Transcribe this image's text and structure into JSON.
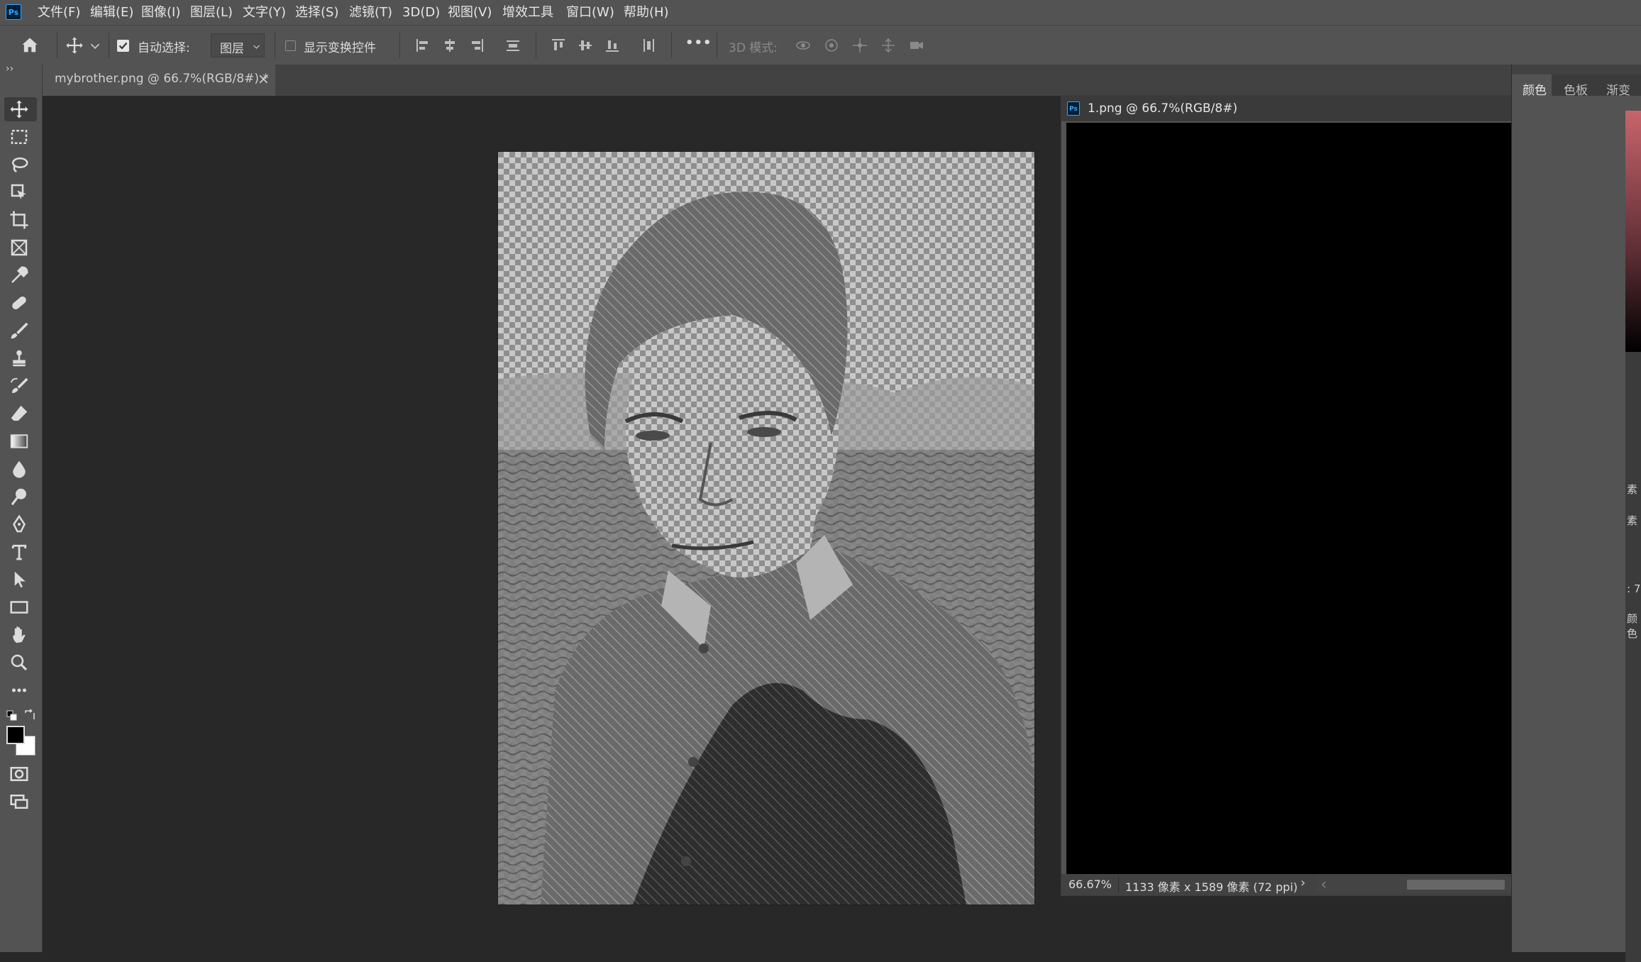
{
  "menubar": {
    "app_logo": "Ps",
    "items": [
      "文件(F)",
      "编辑(E)",
      "图像(I)",
      "图层(L)",
      "文字(Y)",
      "选择(S)",
      "滤镜(T)",
      "3D(D)",
      "视图(V)",
      "增效工具",
      "窗口(W)",
      "帮助(H)"
    ]
  },
  "options": {
    "auto_select_label": "自动选择:",
    "auto_select_checked": true,
    "auto_select_target": "图层",
    "show_transform_label": "显示变换控件",
    "show_transform_checked": false,
    "more_label": "•••",
    "mode_3d_label": "3D 模式:"
  },
  "toolbar": {
    "collapse_label": "››",
    "tools": [
      "move-tool",
      "marquee-tool",
      "lasso-tool",
      "object-select-tool",
      "crop-tool",
      "frame-tool",
      "eyedropper-tool",
      "healing-brush-tool",
      "brush-tool",
      "clone-stamp-tool",
      "history-brush-tool",
      "eraser-tool",
      "gradient-tool",
      "blur-tool",
      "dodge-tool",
      "pen-tool",
      "type-tool",
      "path-select-tool",
      "rectangle-tool",
      "hand-tool",
      "zoom-tool",
      "edit-toolbar"
    ],
    "foreground_color": "#000000",
    "background_color": "#ffffff"
  },
  "document": {
    "tab_title": "mybrother.png @ 66.7%(RGB/8#) *",
    "tab_close": "×"
  },
  "float_window": {
    "icon": "Ps",
    "title": "1.png @ 66.7%(RGB/8#)",
    "zoom": "66.67%",
    "doc_info": "1133 像素 x 1589 像素 (72 ppi)",
    "info_arrow": "›"
  },
  "right_panel": {
    "tabs": [
      "颜色",
      "色板",
      "渐变"
    ],
    "snippets": [
      "素",
      "素",
      ": 7",
      "颜色"
    ]
  }
}
